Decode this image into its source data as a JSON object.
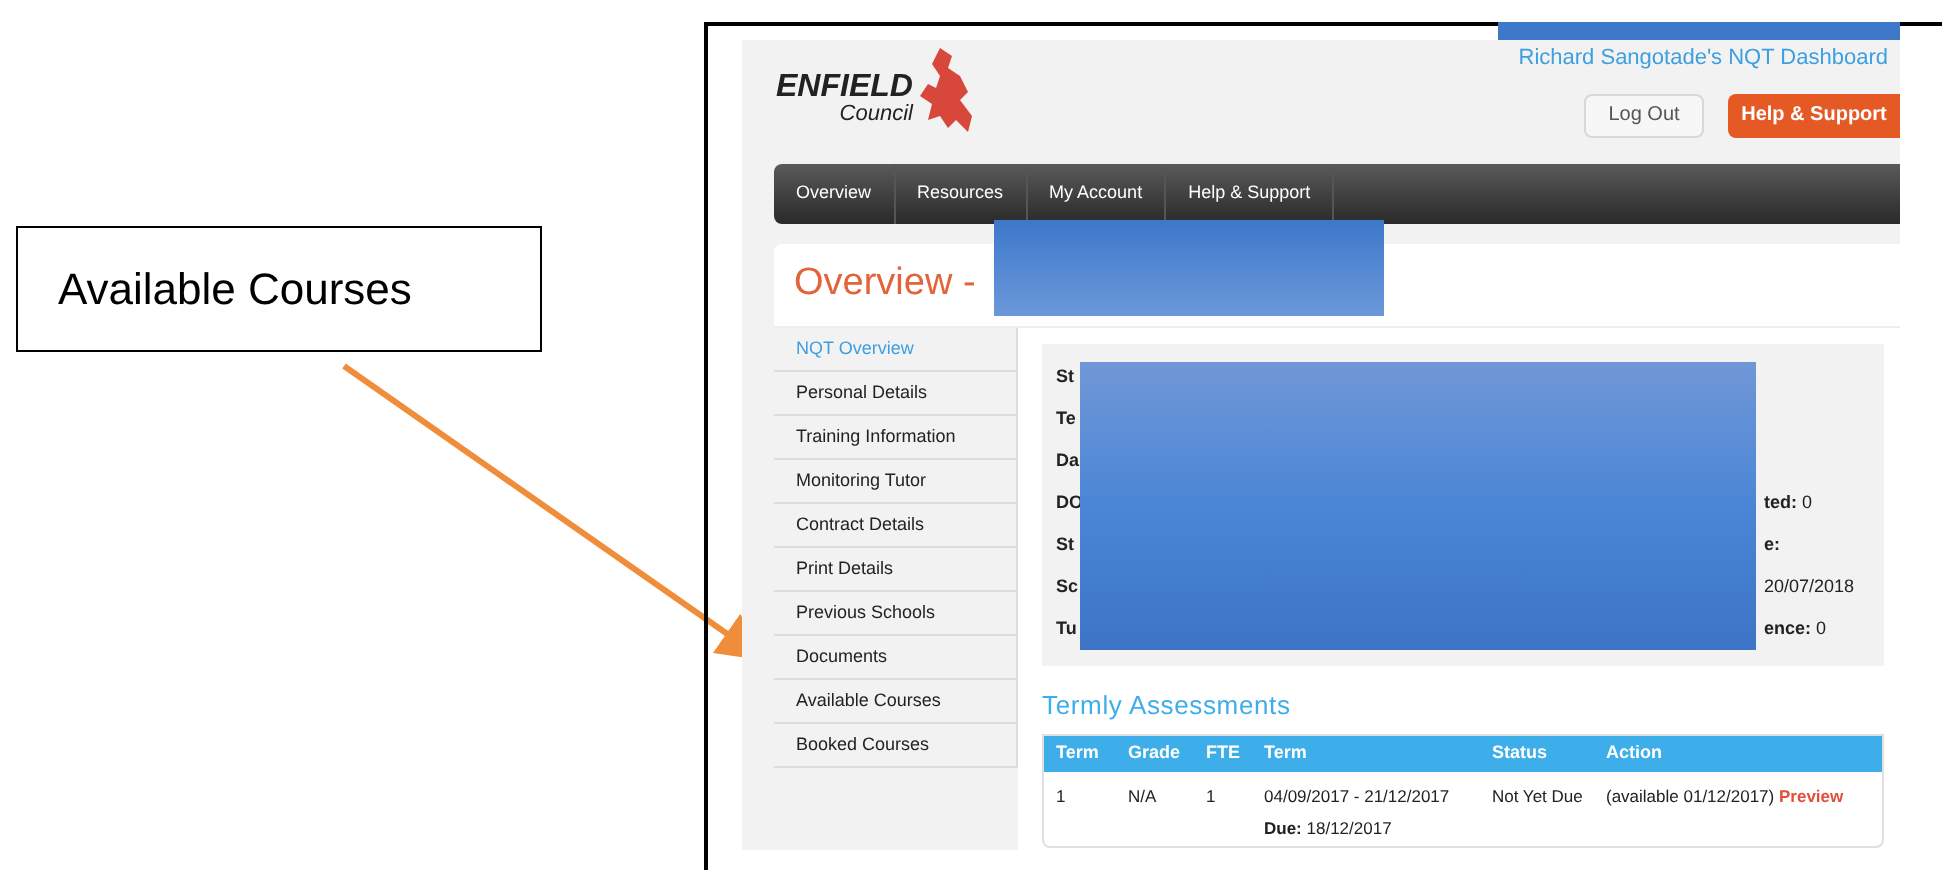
{
  "callout": {
    "label": "Available Courses"
  },
  "logo": {
    "name": "ENFIELD",
    "subtitle": "Council"
  },
  "header": {
    "user_title": "Richard Sangotade's NQT Dashboard",
    "buttons": [
      {
        "label": "Log Out",
        "kind": "plain"
      },
      {
        "label": "Help & Support",
        "kind": "accent"
      }
    ]
  },
  "nav": [
    {
      "label": "Overview"
    },
    {
      "label": "Resources"
    },
    {
      "label": "My Account"
    },
    {
      "label": "Help & Support"
    }
  ],
  "page_title": "Overview -",
  "sidebar": [
    {
      "label": "NQT Overview",
      "selected": true
    },
    {
      "label": "Personal Details",
      "selected": false
    },
    {
      "label": "Training Information",
      "selected": false
    },
    {
      "label": "Monitoring Tutor",
      "selected": false
    },
    {
      "label": "Contract Details",
      "selected": false
    },
    {
      "label": "Print Details",
      "selected": false
    },
    {
      "label": "Previous Schools",
      "selected": false
    },
    {
      "label": "Documents",
      "selected": false
    },
    {
      "label": "Available Courses",
      "selected": false
    },
    {
      "label": "Booked Courses",
      "selected": false
    }
  ],
  "info_rows": [
    {
      "label": "St"
    },
    {
      "label": "Te"
    },
    {
      "label": "Da"
    },
    {
      "label": "DO",
      "right": "**ted:** 0"
    },
    {
      "label": "St",
      "right": "**e:**"
    },
    {
      "label": "Sc",
      "right": "20/07/2018"
    },
    {
      "label": "Tu",
      "right": "**ence:** 0"
    }
  ],
  "assessments": {
    "title": "Termly Assessments",
    "columns": [
      "Term",
      "Grade",
      "FTE",
      "Term",
      "Status",
      "Action"
    ],
    "rows": [
      {
        "term": "1",
        "grade": "N/A",
        "fte": "1",
        "dates": "04/09/2017 - 21/12/2017",
        "due": "**Due:** 18/12/2017",
        "status": "Not Yet Due",
        "action": "(available 01/12/2017)",
        "link": "Preview"
      }
    ]
  }
}
